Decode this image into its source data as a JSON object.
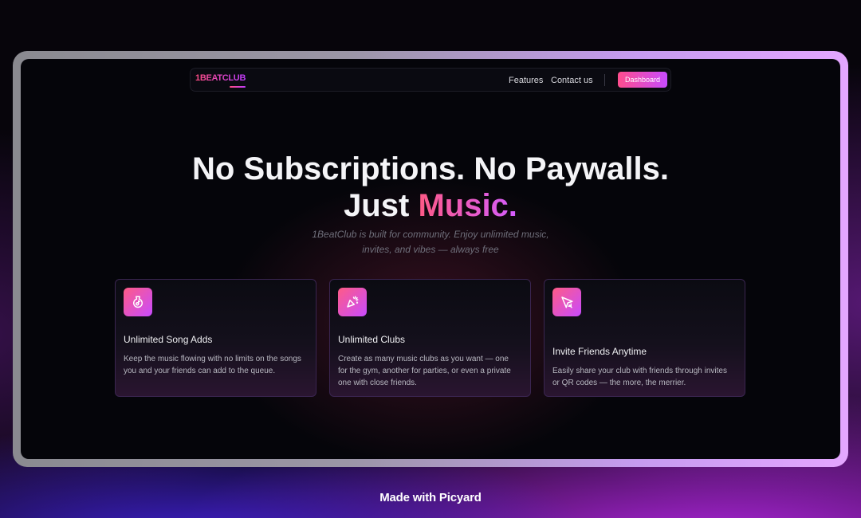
{
  "nav": {
    "logo": "1BEATCLUB",
    "links": [
      "Features",
      "Contact us"
    ],
    "cta": "Dashboard"
  },
  "hero": {
    "line1": "No Subscriptions. No Paywalls.",
    "line2_prefix": "Just",
    "line2_accent": "Music.",
    "subtitle_line1": "1BeatClub is built for community. Enjoy unlimited music,",
    "subtitle_line2": "invites, and vibes — always free"
  },
  "features": [
    {
      "icon": "music-bag-icon",
      "title": "Unlimited Song Adds",
      "desc": "Keep the music flowing with no limits on the songs you and your friends can add to the queue."
    },
    {
      "icon": "party-popper-icon",
      "title": "Unlimited Clubs",
      "desc": "Create as many music clubs as you want — one for the gym, another for parties, or even a private one with close friends."
    },
    {
      "icon": "cursor-icon",
      "title": "Invite Friends Anytime",
      "desc": "Easily share your club with friends through invites or QR codes — the more, the merrier."
    }
  ],
  "footer": "Made with Picyard",
  "colors": {
    "accent_pink": "#ff4d8d",
    "accent_purple": "#c84bff",
    "background": "#05050a"
  }
}
